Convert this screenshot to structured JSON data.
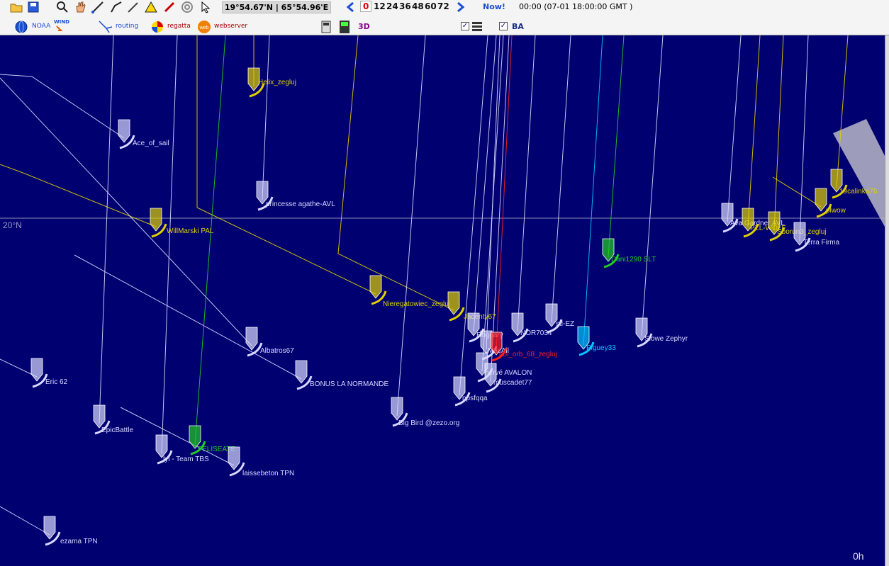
{
  "toolbar": {
    "coords": "19°54.67'N | 65°54.96'E",
    "hours": [
      "0",
      "12",
      "24",
      "36",
      "48",
      "60",
      "72"
    ],
    "now_label": "Now!",
    "gmt_time": "00:00 (07-01 18:00:00 GMT )",
    "noaa_label": "NOAA",
    "wind_label": "WIND",
    "routing_label": "routing",
    "regatta_label": "regatta",
    "webserver_label": "webserver",
    "threed_label": "3D",
    "ba_label": "BA",
    "check_mark": "✓"
  },
  "map": {
    "lat_label": "20°N",
    "time_label": "0h"
  },
  "boats": [
    {
      "name": "Helix_zegluj",
      "color": "#e0d000"
    },
    {
      "name": "Ace_of_sail",
      "color": "#d8d8ff"
    },
    {
      "name": "princesse agathe-AVL",
      "color": "#d8d8ff"
    },
    {
      "name": "WillMarski PAL",
      "color": "#e0d000"
    },
    {
      "name": "Albatros67",
      "color": "#d8d8ff"
    },
    {
      "name": "BONUS LA NORMANDE",
      "color": "#d8d8ff"
    },
    {
      "name": "Eric 62",
      "color": "#d8d8ff"
    },
    {
      "name": "EpicBattle",
      "color": "#d8d8ff"
    },
    {
      "name": "FELISEATE",
      "color": "#22cc22"
    },
    {
      "name": "lyl - Team TBS",
      "color": "#d8d8ff"
    },
    {
      "name": "laissebeton TPN",
      "color": "#d8d8ff"
    },
    {
      "name": "ezama TPN",
      "color": "#d8d8ff"
    },
    {
      "name": "Nieregatowiec_zegluj",
      "color": "#e0d000"
    },
    {
      "name": "Jacenty67",
      "color": "#e0d000"
    },
    {
      "name": "Big Bird @zezo.org",
      "color": "#d8d8ff"
    },
    {
      "name": "npsfqqa",
      "color": "#d8d8ff"
    },
    {
      "name": "Roggary",
      "color": "#d8d8ff"
    },
    {
      "name": "MacAll",
      "color": "#d8d8ff"
    },
    {
      "name": "hervé AVALON",
      "color": "#d8d8ff"
    },
    {
      "name": "muscadet77",
      "color": "#d8d8ff"
    },
    {
      "name": "NOR7034",
      "color": "#d8d8ff"
    },
    {
      "name": "stl-EZ",
      "color": "#d8d8ff"
    },
    {
      "name": "Piguey33",
      "color": "#00c8ff"
    },
    {
      "name": "Dani1290 SLT",
      "color": "#22cc22"
    },
    {
      "name": "Slowe Zephyr",
      "color": "#d8d8ff"
    },
    {
      "name": "Ava Gardner AVL",
      "color": "#d8d8ff"
    },
    {
      "name": "PZL-WOLF",
      "color": "#e0d000"
    },
    {
      "name": "Sborun3_zegluj",
      "color": "#e0d000"
    },
    {
      "name": "Terra Firma",
      "color": "#d8d8ff"
    },
    {
      "name": "plwow",
      "color": "#e0d000"
    },
    {
      "name": "19calinka76",
      "color": "#e0d000"
    },
    {
      "name": "pol_orb_68_zegluj",
      "color": "#ff2020"
    }
  ]
}
